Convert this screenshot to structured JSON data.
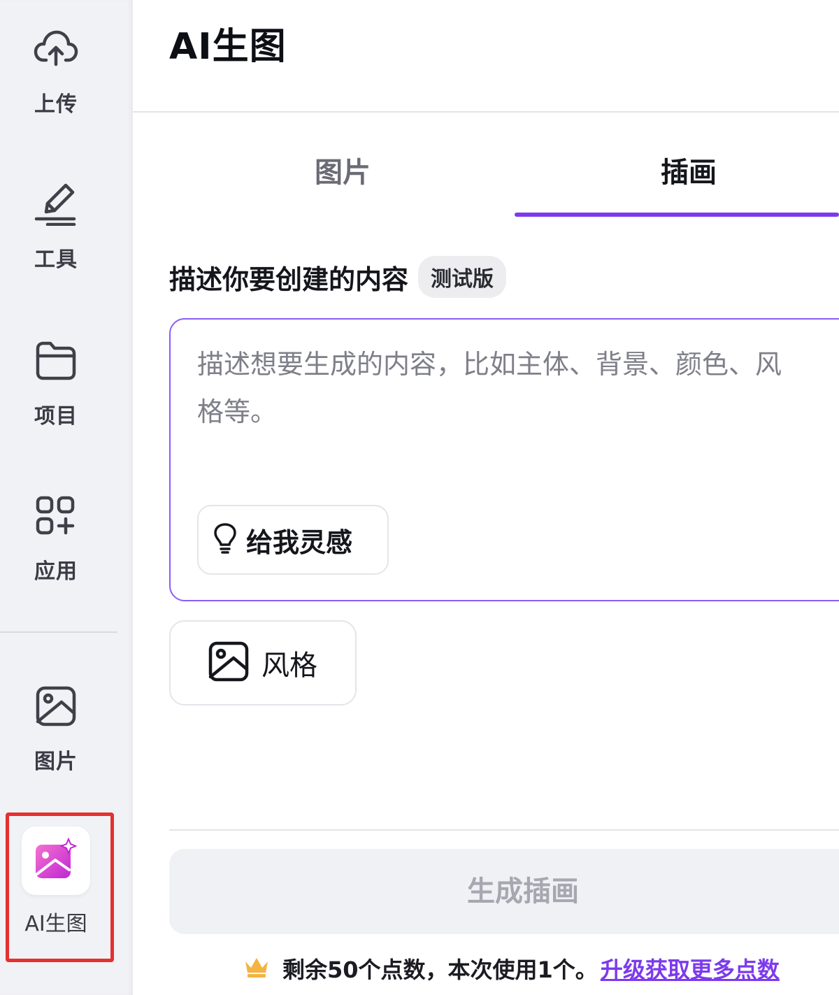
{
  "sidebar": {
    "items": [
      {
        "label": "上传",
        "icon": "cloud-upload-icon"
      },
      {
        "label": "工具",
        "icon": "pen-tool-icon"
      },
      {
        "label": "项目",
        "icon": "folder-icon"
      },
      {
        "label": "应用",
        "icon": "apps-grid-icon"
      },
      {
        "label": "图片",
        "icon": "image-icon"
      },
      {
        "label": "AI生图",
        "icon": "ai-magic-image-icon",
        "selected": true
      }
    ]
  },
  "header": {
    "title": "AI生图"
  },
  "tabs": [
    {
      "label": "图片",
      "active": false
    },
    {
      "label": "插画",
      "active": true
    }
  ],
  "prompt_section": {
    "title": "描述你要创建的内容",
    "badge": "测试版",
    "placeholder": "描述想要生成的内容，比如主体、背景、颜色、风格等。",
    "value": "",
    "inspire_button": "给我灵感"
  },
  "style_button": {
    "label": "风格"
  },
  "generate_button": {
    "label": "生成插画",
    "enabled": false
  },
  "credits": {
    "text": "剩余50个点数，本次使用1个。",
    "upgrade_link": "升级获取更多点数"
  },
  "colors": {
    "accent": "#7c3aed",
    "prompt_border": "#8b5cf6",
    "highlight_box": "#e53030",
    "ai_icon_gradient_start": "#f472d0",
    "ai_icon_gradient_end": "#c026d3",
    "crown": "#f5b342"
  }
}
